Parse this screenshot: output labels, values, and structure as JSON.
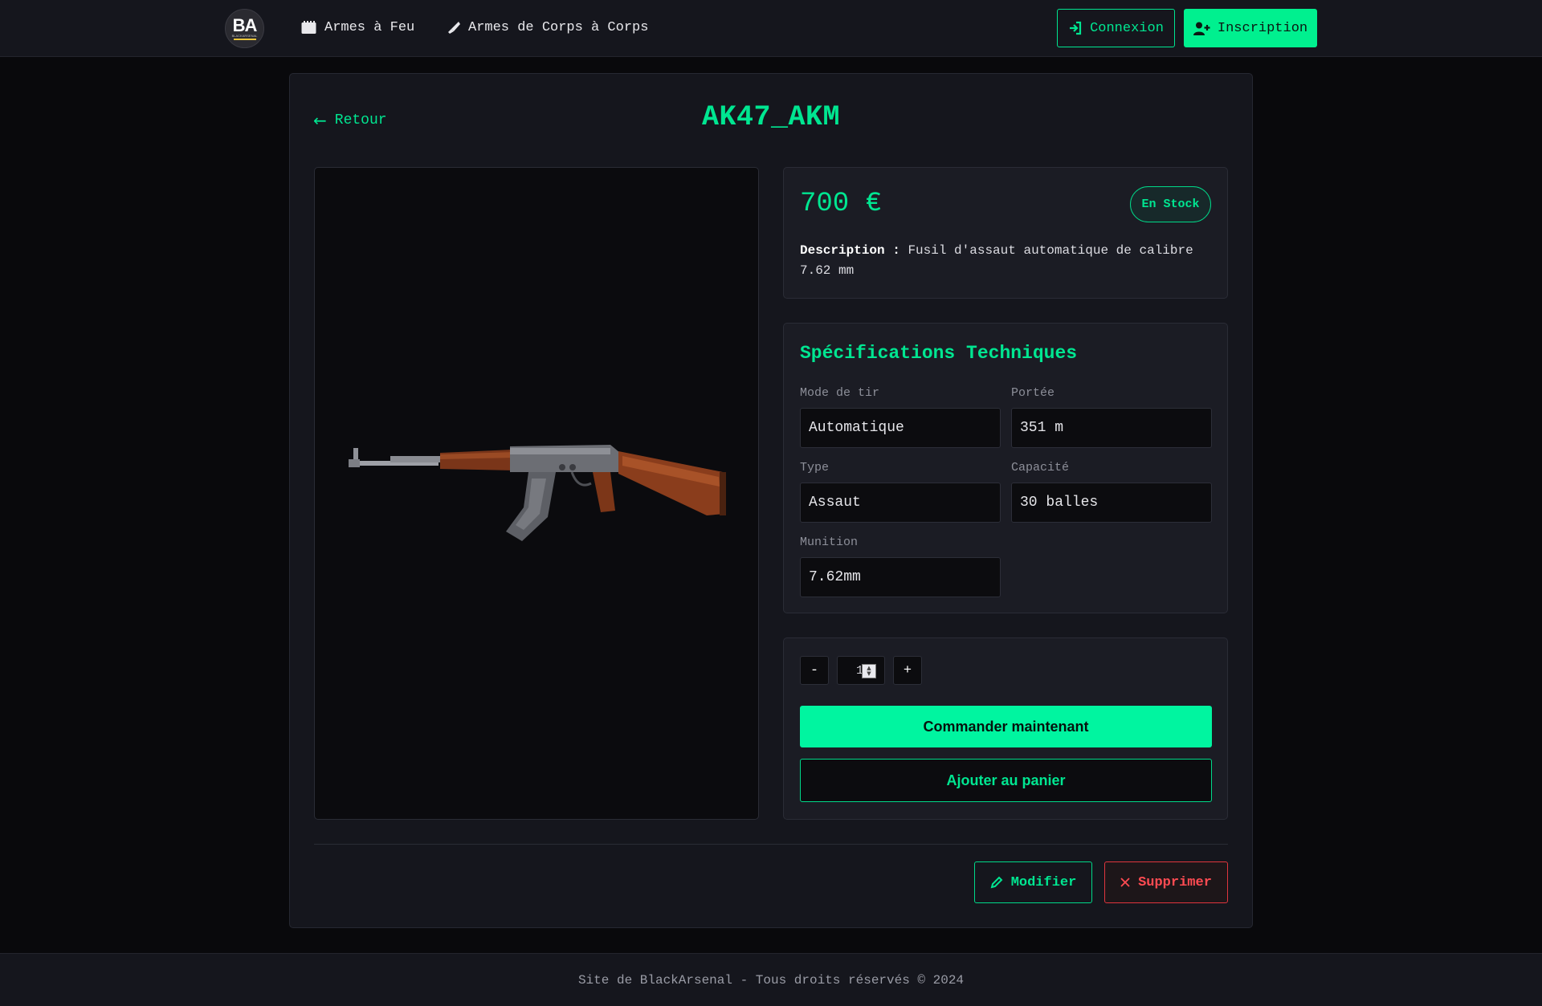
{
  "navbar": {
    "logo_text": "BA",
    "logo_subtext": "BLACKARSENAL",
    "links": [
      {
        "label": "Armes à Feu",
        "icon": "firearm-icon"
      },
      {
        "label": "Armes de Corps à Corps",
        "icon": "knife-icon"
      }
    ],
    "login_label": "Connexion",
    "register_label": "Inscription"
  },
  "product": {
    "back_label": "Retour",
    "title": "AK47_AKM",
    "price": "700 €",
    "stock_badge": "En Stock",
    "description_label": "Description :",
    "description": "Fusil d'assaut automatique de calibre 7.62 mm",
    "image_subject": "ak47-rifle"
  },
  "specs": {
    "title": "Spécifications Techniques",
    "fields": [
      {
        "label": "Mode de tir",
        "value": "Automatique"
      },
      {
        "label": "Portée",
        "value": "351 m"
      },
      {
        "label": "Type",
        "value": "Assaut"
      },
      {
        "label": "Capacité",
        "value": "30 balles"
      },
      {
        "label": "Munition",
        "value": "7.62mm"
      }
    ]
  },
  "order": {
    "decrement_label": "-",
    "quantity": "1",
    "increment_label": "+",
    "order_label": "Commander maintenant",
    "cart_label": "Ajouter au panier"
  },
  "admin": {
    "edit_label": "Modifier",
    "delete_label": "Supprimer"
  },
  "footer": {
    "text": "Site de BlackArsenal - Tous droits réservés © 2024"
  },
  "colors": {
    "accent": "#00e691",
    "background": "#09090c",
    "card": "#15161d",
    "danger": "#ff4b52"
  }
}
